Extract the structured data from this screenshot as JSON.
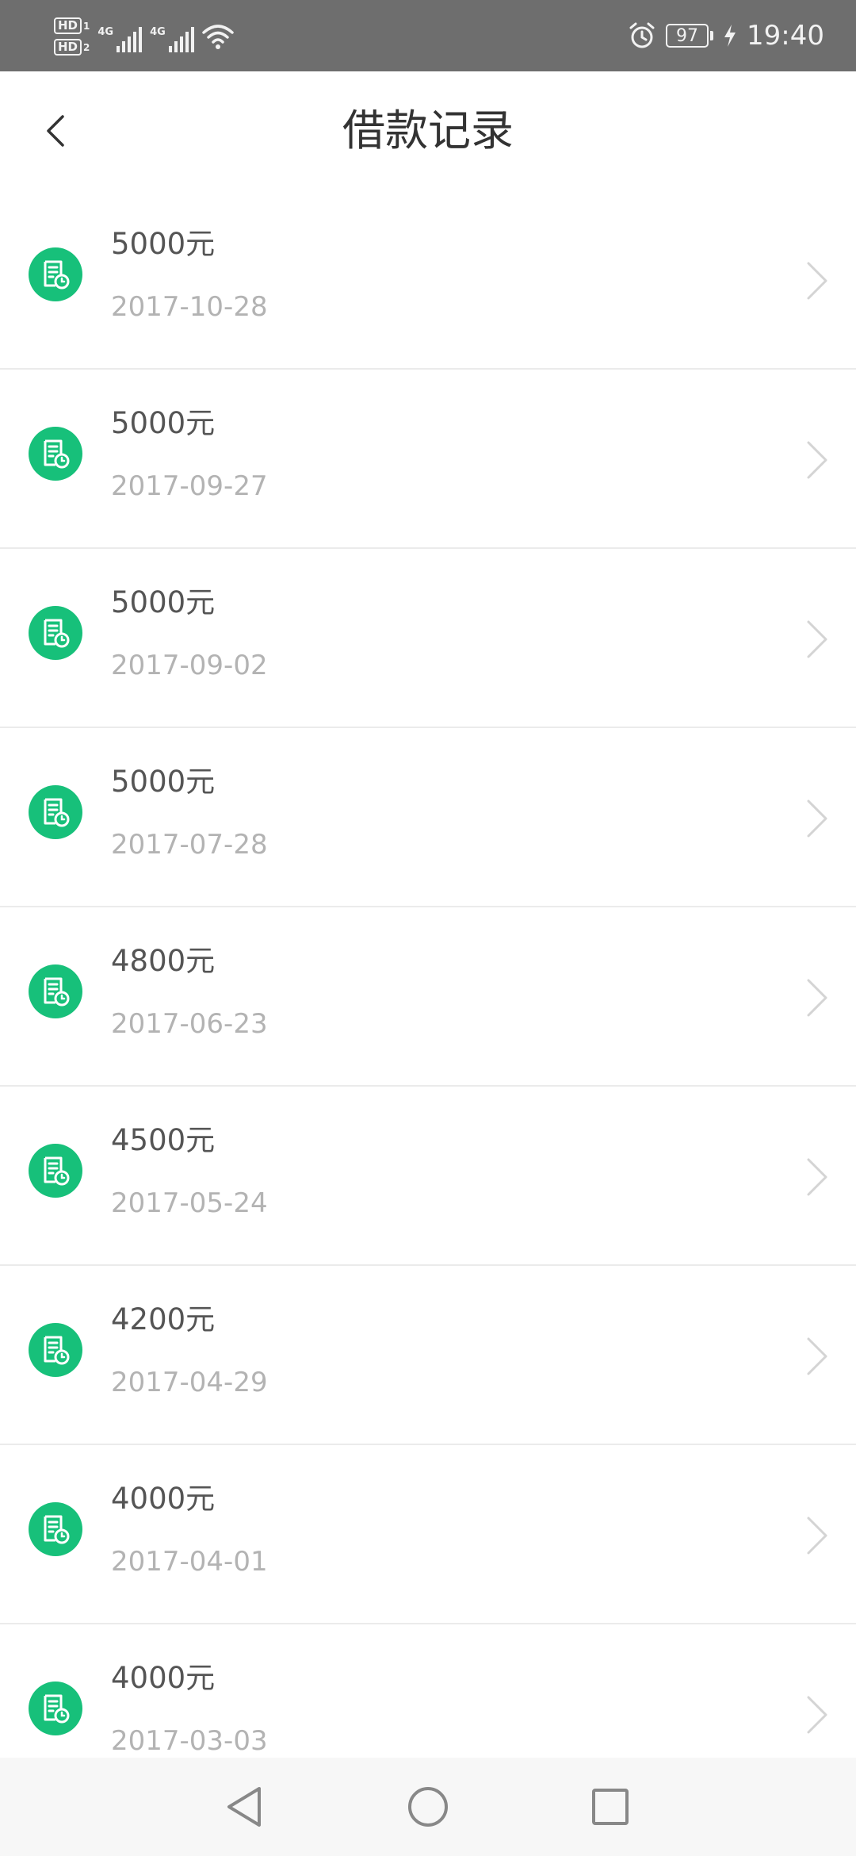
{
  "status_bar": {
    "sim1": "HD",
    "sim1_index": "1",
    "sim2": "HD",
    "sim2_index": "2",
    "net1": "4G",
    "net2": "4G",
    "battery": "97",
    "time": "19:40",
    "icons": [
      "hd-icon",
      "signal-icon",
      "wifi-icon",
      "alarm-icon",
      "battery-icon",
      "charging-icon"
    ]
  },
  "header": {
    "title": "借款记录",
    "back_icon": "chevron-left-icon"
  },
  "records": [
    {
      "amount": "5000元",
      "date": "2017-10-28"
    },
    {
      "amount": "5000元",
      "date": "2017-09-27"
    },
    {
      "amount": "5000元",
      "date": "2017-09-02"
    },
    {
      "amount": "5000元",
      "date": "2017-07-28"
    },
    {
      "amount": "4800元",
      "date": "2017-06-23"
    },
    {
      "amount": "4500元",
      "date": "2017-05-24"
    },
    {
      "amount": "4200元",
      "date": "2017-04-29"
    },
    {
      "amount": "4000元",
      "date": "2017-04-01"
    },
    {
      "amount": "4000元",
      "date": "2017-03-03"
    }
  ],
  "colors": {
    "accent": "#17c07a",
    "status_bar": "#6e6e6e",
    "title_text": "#333333",
    "amount_text": "#555555",
    "date_text": "#b3b3b3"
  },
  "nav_bar": {
    "icons": [
      "back-triangle-icon",
      "home-circle-icon",
      "recents-square-icon"
    ]
  }
}
